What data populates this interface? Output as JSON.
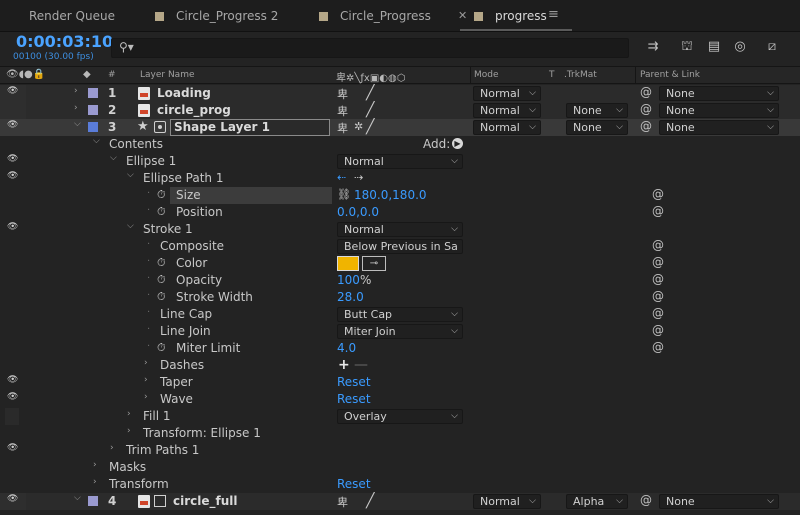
{
  "tabs": [
    "Render Queue",
    "Circle_Progress 2",
    "Circle_Progress",
    "progress"
  ],
  "timecode": "0:00:03:10",
  "fps": "00100 (30.00 fps)",
  "columns": {
    "layer_name": "Layer Name",
    "hash": "#",
    "mode": "Mode",
    "t": "T",
    "trkmat": ".TrkMat",
    "parent": "Parent & Link"
  },
  "layers": [
    {
      "num": "1",
      "name": "Loading",
      "mode": "Normal",
      "trkmat": "",
      "parent": "None",
      "label_color": "#9a9ad0"
    },
    {
      "num": "2",
      "name": "circle_prog",
      "mode": "Normal",
      "trkmat": "None",
      "parent": "None",
      "label_color": "#9a9ad0"
    },
    {
      "num": "3",
      "name": "Shape Layer 1",
      "mode": "Normal",
      "trkmat": "None",
      "parent": "None",
      "label_color": "#5a7cd8"
    }
  ],
  "last_layer": {
    "num": "4",
    "name": "circle_full",
    "mode": "Normal",
    "trkmat": "Alpha",
    "parent": "None",
    "label_color": "#9a9ad0"
  },
  "props": {
    "contents": "Contents",
    "add": "Add:",
    "ellipse1": "Ellipse 1",
    "ellipse1_mode": "Normal",
    "ellipse_path1": "Ellipse Path 1",
    "size": "Size",
    "size_val": "180.0,180.0",
    "position": "Position",
    "position_val": "0.0,0.0",
    "stroke1": "Stroke 1",
    "stroke1_mode": "Normal",
    "composite": "Composite",
    "composite_val": "Below Previous in Sa",
    "color": "Color",
    "opacity": "Opacity",
    "opacity_val": "100",
    "opacity_unit": "%",
    "stroke_width": "Stroke Width",
    "stroke_width_val": "28.0",
    "line_cap": "Line Cap",
    "line_cap_val": "Butt Cap",
    "line_join": "Line Join",
    "line_join_val": "Miter Join",
    "miter_limit": "Miter Limit",
    "miter_limit_val": "4.0",
    "dashes": "Dashes",
    "taper": "Taper",
    "taper_val": "Reset",
    "wave": "Wave",
    "wave_val": "Reset",
    "fill1": "Fill 1",
    "fill1_mode": "Overlay",
    "transform_ellipse": "Transform: Ellipse 1",
    "trim_paths": "Trim Paths 1",
    "masks": "Masks",
    "transform": "Transform",
    "transform_val": "Reset"
  },
  "colors": {
    "stroke_color": "#f0b400",
    "accent": "#3a9bff"
  }
}
